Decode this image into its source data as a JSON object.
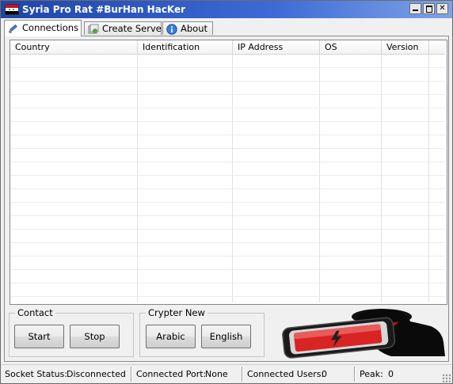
{
  "window": {
    "title": "Syria Pro Rat #BurHan HacKer"
  },
  "tabs": [
    {
      "label": "Connections",
      "icon": "satellite-icon"
    },
    {
      "label": "Create Server",
      "icon": "server-box-icon"
    },
    {
      "label": "About",
      "icon": "info-icon"
    }
  ],
  "connections_table": {
    "columns": [
      "Country",
      "Identification",
      "IP Address",
      "OS",
      "Version"
    ],
    "rows": []
  },
  "contact_group": {
    "title": "Contact",
    "start_label": "Start",
    "stop_label": "Stop"
  },
  "crypter_group": {
    "title": "Crypter New",
    "arabic_label": "Arabic",
    "english_label": "English"
  },
  "status_bar": {
    "socket_status_label": "Socket Status:",
    "socket_status_value": "Disconnected",
    "connected_port_label": "Connected Port:",
    "connected_port_value": "None",
    "connected_users_label": "Connected Users:",
    "connected_users_value": "0",
    "peak_label": "Peak:",
    "peak_value": "0"
  },
  "colors": {
    "titlebar_start": "#1f45a8",
    "titlebar_end": "#7fa3e6",
    "phone_screen": "#d92424",
    "hacker_eyes": "#e01010"
  }
}
